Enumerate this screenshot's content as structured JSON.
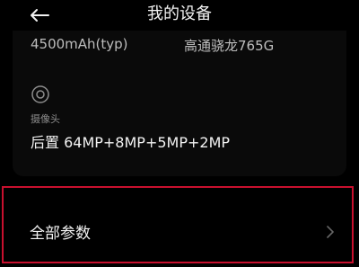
{
  "header": {
    "title": "我的设备"
  },
  "specs": {
    "battery": "4500mAh(typ)",
    "chip": "高通骁龙765G",
    "camera_label": "摄像头",
    "camera_value": "后置 64MP+8MP+5MP+2MP"
  },
  "all_params": {
    "label": "全部参数"
  },
  "colors": {
    "background": "#000000",
    "highlight_border": "#c8102e"
  },
  "icons": {
    "back": "back-arrow-icon",
    "camera": "camera-icon",
    "chevron": "chevron-right-icon"
  }
}
